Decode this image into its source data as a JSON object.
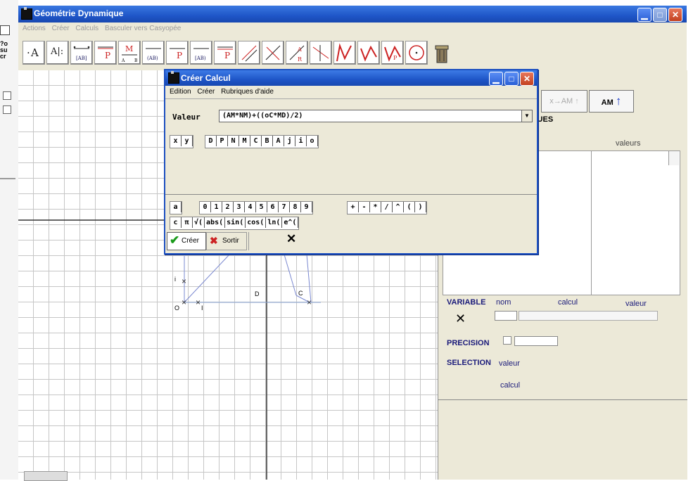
{
  "window": {
    "title": "Géométrie Dynamique",
    "menu": [
      "Actions",
      "Créer",
      "Calculs",
      "Basculer vers Casyopée"
    ]
  },
  "toolbar": {
    "tools": [
      "A",
      "A|:",
      "[AB]",
      "P",
      "M",
      "[AB]",
      "P",
      "[AB]",
      "P",
      "parallel",
      "perpendicular",
      "R",
      "curve",
      "function",
      "fp",
      "circle",
      "trash"
    ]
  },
  "left_strip": [
    "?o",
    "su",
    "cr"
  ],
  "canvas": {
    "points": [
      "I",
      "O",
      "i",
      "D",
      "C"
    ]
  },
  "right_panel": {
    "btn_xy": "x",
    "btn_xy_arrow": "→AM",
    "btn_am": "AM",
    "section": "QUES",
    "col_names": "ls",
    "col_values": "valeurs",
    "variable_label": "VARIABLE",
    "variable_nom": "nom",
    "variable_calcul": "calcul",
    "variable_valeur": "valeur",
    "precision_label": "PRECISION",
    "selection_label": "SELECTION",
    "selection_valeur": "valeur",
    "selection_calcul": "calcul"
  },
  "dialog": {
    "title": "Créer Calcul",
    "menu": [
      "Edition",
      "Créer",
      "Rubriques d'aide"
    ],
    "valeur_label": "Valeur",
    "valeur_value": "(AM*NM)+((oC*MD)/2)",
    "var_keys_xy": [
      "x",
      "y"
    ],
    "var_keys_points": [
      "D",
      "P",
      "N",
      "M",
      "C",
      "B",
      "A",
      "j",
      "i",
      "o"
    ],
    "row_a": "a",
    "digits": [
      "0",
      "1",
      "2",
      "3",
      "4",
      "5",
      "6",
      "7",
      "8",
      "9"
    ],
    "ops": [
      "+",
      "-",
      "*",
      "/",
      "^",
      "(",
      ")"
    ],
    "row_c": "c",
    "funcs": [
      "π",
      "√(",
      "abs(",
      "sin(",
      "cos(",
      "ln(",
      "e^("
    ],
    "creer": "Créer",
    "sortir": "Sortir",
    "cross": "✕"
  },
  "colors": {
    "title_blue": "#1f56c8",
    "chrome": "#ece9d8",
    "close_red": "#c3401f",
    "accent_green": "#1a9a1a"
  }
}
